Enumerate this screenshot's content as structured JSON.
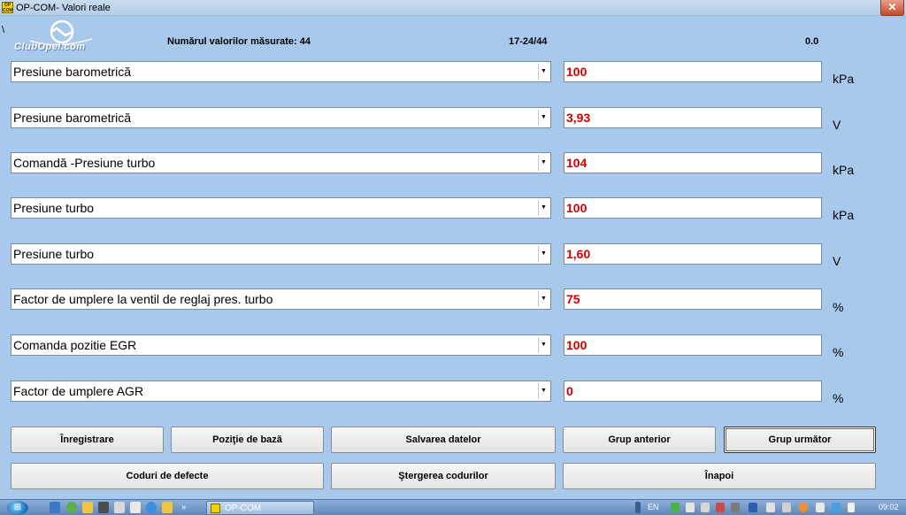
{
  "window": {
    "title": "OP-COM- Valori reale",
    "app_icon": "OP COM",
    "close_label": "✕"
  },
  "logo": {
    "text": "ClubOpel.com"
  },
  "header": {
    "marker": "\\",
    "count_label": "Numărul valorilor măsurate: 44",
    "range": "17-24/44",
    "time_value": "0.0"
  },
  "rows": [
    {
      "name": "Presiune barometrică",
      "value": "100",
      "unit": "kPa"
    },
    {
      "name": "Presiune barometrică",
      "value": "3,93",
      "unit": "V"
    },
    {
      "name": "Comandă -Presiune turbo",
      "value": "104",
      "unit": "kPa"
    },
    {
      "name": "Presiune turbo",
      "value": "100",
      "unit": "kPa"
    },
    {
      "name": "Presiune turbo",
      "value": "1,60",
      "unit": "V"
    },
    {
      "name": "Factor de umplere la ventil  de reglaj pres. turbo",
      "value": "75",
      "unit": "%"
    },
    {
      "name": "Comanda pozitie EGR",
      "value": "100",
      "unit": "%"
    },
    {
      "name": "Factor de umplere AGR",
      "value": "0",
      "unit": "%"
    }
  ],
  "buttons": {
    "record": "Înregistrare",
    "base_position": "Poziţie de bază",
    "save_data": "Salvarea datelor",
    "prev_group": "Grup anterior",
    "next_group": "Grup următor",
    "fault_codes": "Coduri de defecte",
    "clear_codes": "Ştergerea codurilor",
    "back": "Înapoi"
  },
  "taskbar": {
    "active_task": "OP-COM",
    "language": "EN",
    "clock": "09:02",
    "overflow": "»"
  },
  "colors": {
    "background": "#a9c9ec",
    "value_text": "#d00000"
  }
}
